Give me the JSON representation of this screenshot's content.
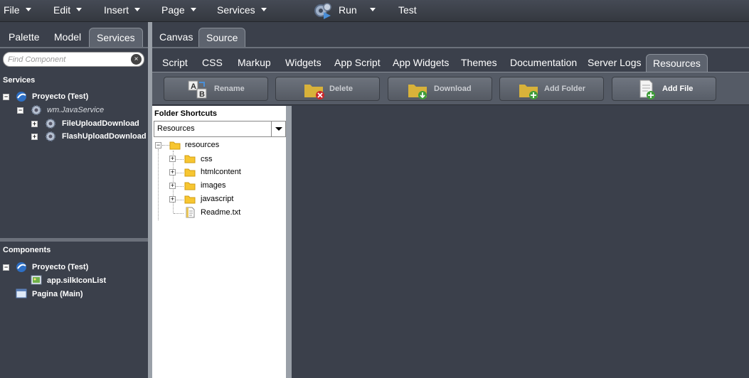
{
  "menubar": {
    "items": [
      {
        "label": "File"
      },
      {
        "label": "Edit"
      },
      {
        "label": "Insert"
      },
      {
        "label": "Page"
      },
      {
        "label": "Services"
      }
    ],
    "run_label": "Run",
    "test_label": "Test"
  },
  "left_tabs": [
    "Palette",
    "Model",
    "Services"
  ],
  "main_tabs": [
    "Canvas",
    "Source"
  ],
  "search": {
    "placeholder": "Find Component",
    "clear_icon": "×"
  },
  "services_tree": {
    "title": "Services",
    "root": "Proyecto (Test)",
    "child": "wm.JavaService",
    "grandchildren": [
      "FileUploadDownload",
      "FlashUploadDownload"
    ]
  },
  "components_tree": {
    "title": "Components",
    "root": "Proyecto (Test)",
    "child": "app.silkIconList",
    "page": "Pagina (Main)"
  },
  "source_tabs": [
    "Script",
    "CSS",
    "Markup",
    "Widgets",
    "App Script",
    "App Widgets",
    "Themes",
    "Documentation",
    "Server Logs",
    "Resources"
  ],
  "toolbar": {
    "buttons": [
      "Rename",
      "Delete",
      "Download",
      "Add Folder",
      "Add File"
    ]
  },
  "folder_panel": {
    "title": "Folder Shortcuts",
    "selected": "Resources",
    "root": "resources",
    "children": [
      "css",
      "htmlcontent",
      "images",
      "javascript"
    ],
    "file": "Readme.txt"
  },
  "colors": {
    "panel_bg": "#3b404b",
    "active_tab": "#5d636e",
    "folder": "#f7c631"
  }
}
